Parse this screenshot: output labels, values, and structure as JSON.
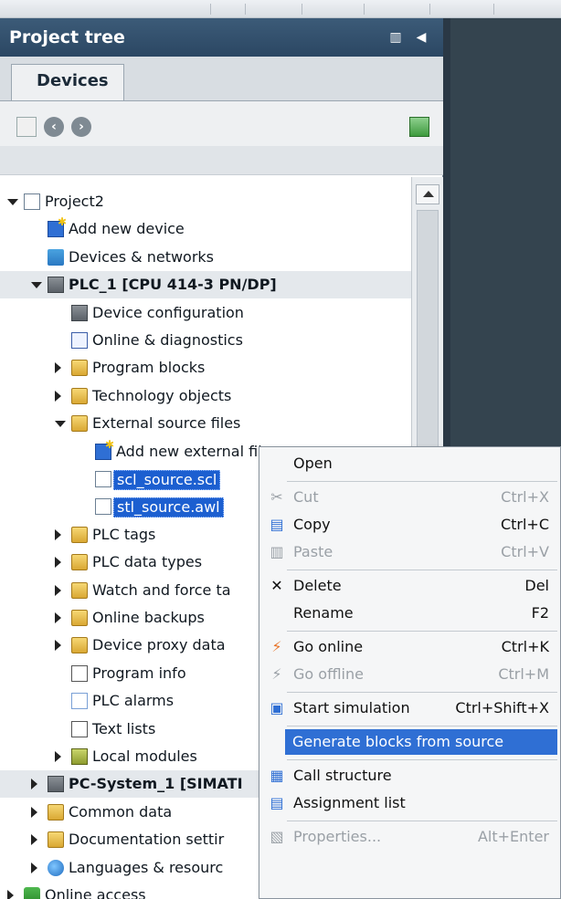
{
  "panel": {
    "title": "Project tree",
    "tab": "Devices"
  },
  "tree": [
    {
      "label": "Project2",
      "indent": 0,
      "arrow": "down",
      "icon": "doc"
    },
    {
      "label": "Add new device",
      "indent": 1,
      "arrow": "",
      "icon": "blue-star"
    },
    {
      "label": "Devices & networks",
      "indent": 1,
      "arrow": "",
      "icon": "net"
    },
    {
      "label": "PLC_1 [CPU 414-3 PN/DP]",
      "indent": 1,
      "arrow": "down",
      "icon": "plc",
      "bold": true,
      "group": true
    },
    {
      "label": "Device configuration",
      "indent": 2,
      "arrow": "",
      "icon": "plc"
    },
    {
      "label": "Online & diagnostics",
      "indent": 2,
      "arrow": "",
      "icon": "diag"
    },
    {
      "label": "Program blocks",
      "indent": 2,
      "arrow": "right",
      "icon": "folder"
    },
    {
      "label": "Technology objects",
      "indent": 2,
      "arrow": "right",
      "icon": "folder"
    },
    {
      "label": "External source files",
      "indent": 2,
      "arrow": "down",
      "icon": "folder"
    },
    {
      "label": "Add new external file",
      "indent": 3,
      "arrow": "",
      "icon": "blue-star"
    },
    {
      "label": "scl_source.scl",
      "indent": 3,
      "arrow": "",
      "icon": "doc",
      "selected": true
    },
    {
      "label": "stl_source.awl",
      "indent": 3,
      "arrow": "",
      "icon": "doc",
      "selected": true
    },
    {
      "label": "PLC tags",
      "indent": 2,
      "arrow": "right",
      "icon": "folder"
    },
    {
      "label": "PLC data types",
      "indent": 2,
      "arrow": "right",
      "icon": "folder"
    },
    {
      "label": "Watch and force ta",
      "indent": 2,
      "arrow": "right",
      "icon": "folder"
    },
    {
      "label": "Online backups",
      "indent": 2,
      "arrow": "right",
      "icon": "folder"
    },
    {
      "label": "Device proxy data",
      "indent": 2,
      "arrow": "right",
      "icon": "folder"
    },
    {
      "label": "Program info",
      "indent": 2,
      "arrow": "",
      "icon": "list"
    },
    {
      "label": "PLC alarms",
      "indent": 2,
      "arrow": "",
      "icon": "mail"
    },
    {
      "label": "Text lists",
      "indent": 2,
      "arrow": "",
      "icon": "list"
    },
    {
      "label": "Local modules",
      "indent": 2,
      "arrow": "right",
      "icon": "mod"
    },
    {
      "label": "PC-System_1 [SIMATI",
      "indent": 1,
      "arrow": "right",
      "icon": "plc",
      "bold": true,
      "group": true
    },
    {
      "label": "Common data",
      "indent": 1,
      "arrow": "right",
      "icon": "folder"
    },
    {
      "label": "Documentation settir",
      "indent": 1,
      "arrow": "right",
      "icon": "folder"
    },
    {
      "label": "Languages & resourc",
      "indent": 1,
      "arrow": "right",
      "icon": "globe"
    },
    {
      "label": "Online access",
      "indent": 0,
      "arrow": "right",
      "icon": "green"
    }
  ],
  "menu": [
    {
      "label": "Open",
      "key": "",
      "icon": "",
      "disabled": false
    },
    {
      "sep": true
    },
    {
      "label": "Cut",
      "key": "Ctrl+X",
      "icon": "scissors-icon",
      "glyph": "✂",
      "disabled": true
    },
    {
      "label": "Copy",
      "key": "Ctrl+C",
      "icon": "copy-icon",
      "glyph": "▤",
      "disabled": false
    },
    {
      "label": "Paste",
      "key": "Ctrl+V",
      "icon": "paste-icon",
      "glyph": "▥",
      "disabled": true
    },
    {
      "sep": true
    },
    {
      "label": "Delete",
      "key": "Del",
      "icon": "delete-icon",
      "glyph": "✕",
      "disabled": false
    },
    {
      "label": "Rename",
      "key": "F2",
      "icon": "",
      "disabled": false
    },
    {
      "sep": true
    },
    {
      "label": "Go online",
      "key": "Ctrl+K",
      "icon": "go-online-icon",
      "glyph": "⚡",
      "disabled": false
    },
    {
      "label": "Go offline",
      "key": "Ctrl+M",
      "icon": "go-offline-icon",
      "glyph": "⚡",
      "disabled": true
    },
    {
      "sep": true
    },
    {
      "label": "Start simulation",
      "key": "Ctrl+Shift+X",
      "icon": "simulation-icon",
      "glyph": "▣",
      "disabled": false
    },
    {
      "sep": true
    },
    {
      "label": "Generate blocks from source",
      "key": "",
      "icon": "",
      "disabled": false,
      "highlighted": true
    },
    {
      "sep": true
    },
    {
      "label": "Call structure",
      "key": "",
      "icon": "call-structure-icon",
      "glyph": "▦",
      "disabled": false
    },
    {
      "label": "Assignment list",
      "key": "",
      "icon": "assignment-list-icon",
      "glyph": "▤",
      "disabled": false
    },
    {
      "sep": true
    },
    {
      "label": "Properties...",
      "key": "Alt+Enter",
      "icon": "properties-icon",
      "glyph": "▧",
      "disabled": true
    }
  ],
  "colors": {
    "header": "#2b4763",
    "selection": "#1c5fd0",
    "highlight": "#2f6fd4"
  }
}
